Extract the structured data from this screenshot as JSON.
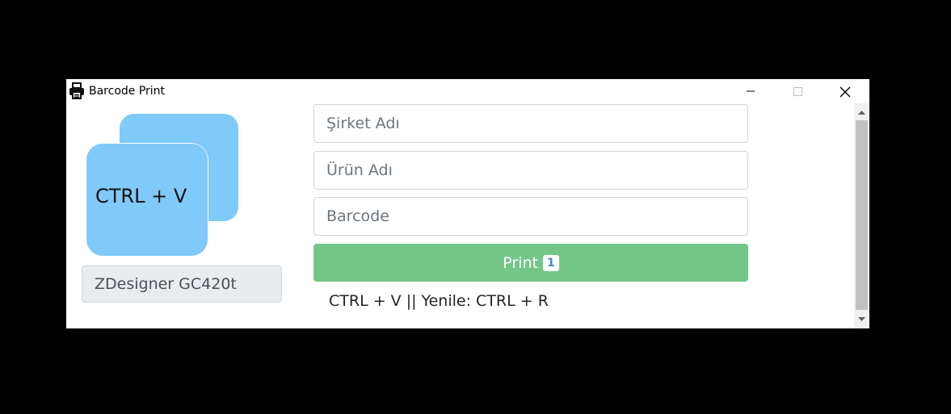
{
  "window": {
    "title": "Barcode Print"
  },
  "logo": {
    "text": "CTRL + V"
  },
  "printer": {
    "value": "ZDesigner GC420t"
  },
  "form": {
    "company_placeholder": "Şirket Adı",
    "product_placeholder": "Ürün Adı",
    "barcode_placeholder": "Barcode",
    "print_label": "Print",
    "print_count": "1"
  },
  "hint": {
    "text": "CTRL + V || Yenile: CTRL + R"
  },
  "colors": {
    "logo_blue": "#7fcaf9",
    "print_green": "#74c686",
    "badge_blue": "#3b8bd6"
  },
  "icons": {
    "app": "printer-icon",
    "minimize": "minimize-icon",
    "maximize": "maximize-icon",
    "close": "close-icon",
    "scroll_up": "arrow-up-icon",
    "scroll_down": "arrow-down-icon"
  }
}
